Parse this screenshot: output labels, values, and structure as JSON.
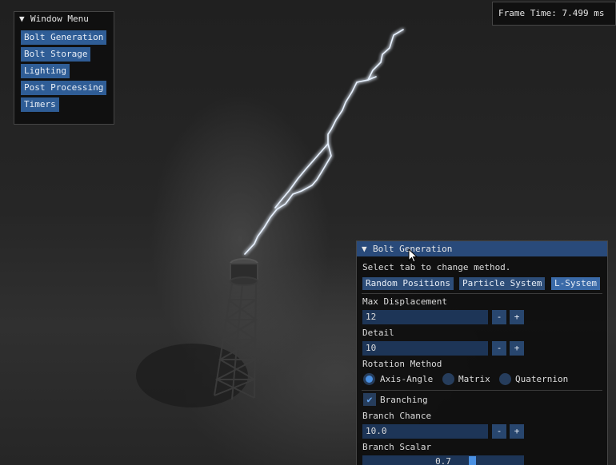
{
  "window_menu": {
    "title": "Window Menu",
    "items": [
      "Bolt Generation",
      "Bolt Storage",
      "Lighting",
      "Post Processing",
      "Timers"
    ]
  },
  "overlay": {
    "frame_time": "Frame Time: 7.499 ms"
  },
  "bolt_generation": {
    "title": "Bolt Generation",
    "hint": "Select tab to change method.",
    "tabs": [
      "Random Positions",
      "Particle System",
      "L-System"
    ],
    "active_tab": "L-System",
    "max_displacement": {
      "label": "Max Displacement",
      "value": "12"
    },
    "detail": {
      "label": "Detail",
      "value": "10"
    },
    "rotation_method": {
      "label": "Rotation Method",
      "options": [
        "Axis-Angle",
        "Matrix",
        "Quaternion"
      ],
      "selected": "Axis-Angle"
    },
    "branching": {
      "label": "Branching",
      "checked": true
    },
    "branch_chance": {
      "label": "Branch Chance",
      "value": "10.0"
    },
    "branch_scalar": {
      "label": "Branch Scalar",
      "value": "0.7"
    },
    "minus": "-",
    "plus": "+"
  },
  "colors": {
    "button": "#2f5d96",
    "title_active": "#294a7a",
    "accent": "#4a90e2",
    "bolt": "#e8f2ff"
  }
}
